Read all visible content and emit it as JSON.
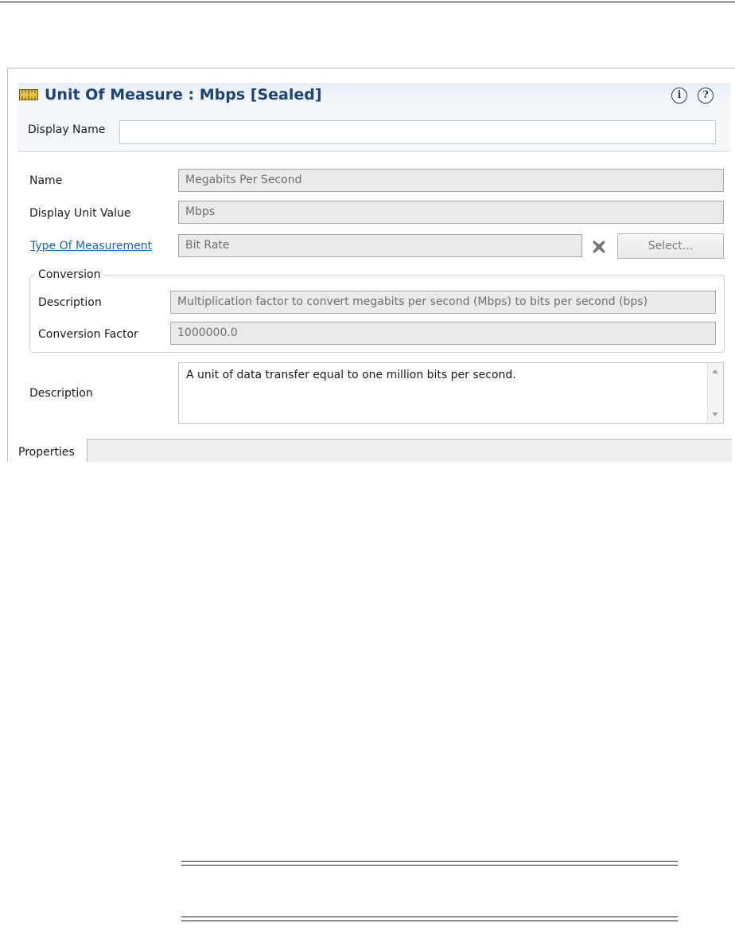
{
  "header": {
    "title": "Unit Of Measure : Mbps [Sealed]",
    "title_icon": "ruler-icon",
    "info_glyph": "i",
    "help_glyph": "?",
    "display_name_label": "Display Name",
    "display_name_value": ""
  },
  "fields": {
    "name_label": "Name",
    "name_value": "Megabits Per Second",
    "display_unit_label": "Display Unit Value",
    "display_unit_value": "Mbps",
    "type_label": "Type Of Measurement",
    "type_value": "Bit Rate",
    "select_label": "Select..."
  },
  "conversion": {
    "group_title": "Conversion",
    "description_label": "Description",
    "description_value": "Multiplication factor to convert megabits per second (Mbps) to bits per second (bps)",
    "factor_label": "Conversion Factor",
    "factor_value": "1000000.0"
  },
  "description": {
    "label": "Description",
    "value": "A unit of data transfer equal to one million bits per second."
  },
  "properties": {
    "label": "Properties"
  },
  "colors": {
    "title": "#19437a",
    "link": "#1565c0",
    "readonly_bg": "#eaeaea",
    "header_bg": "#f3f6fa"
  }
}
